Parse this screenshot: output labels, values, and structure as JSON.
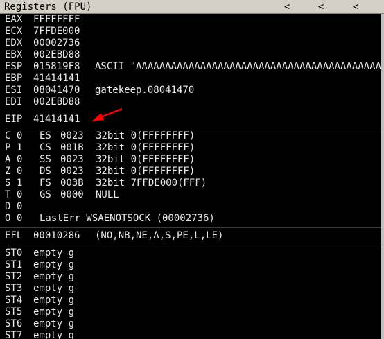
{
  "window": {
    "title": "Registers (FPU)",
    "arrows": [
      "<",
      "<",
      "<"
    ]
  },
  "registers": [
    {
      "name": "EAX",
      "value": "FFFFFFFF",
      "comment": ""
    },
    {
      "name": "ECX",
      "value": "7FFDE000",
      "comment": ""
    },
    {
      "name": "EDX",
      "value": "00002736",
      "comment": ""
    },
    {
      "name": "EBX",
      "value": "002EBD88",
      "comment": ""
    },
    {
      "name": "ESP",
      "value": "015819F8",
      "comment": "ASCII \"AAAAAAAAAAAAAAAAAAAAAAAAAAAAAAAAAAAAAAAAAAAAAAAAAAAAAAAA"
    },
    {
      "name": "EBP",
      "value": "41414141",
      "comment": ""
    },
    {
      "name": "ESI",
      "value": "08041470",
      "comment": "gatekeep.08041470"
    },
    {
      "name": "EDI",
      "value": "002EBD88",
      "comment": ""
    }
  ],
  "eip": {
    "name": "EIP",
    "value": "41414141"
  },
  "flags": [
    {
      "flag": "C",
      "bit": "0",
      "seg": "ES",
      "sel": "0023",
      "desc": "32bit 0(FFFFFFFF)"
    },
    {
      "flag": "P",
      "bit": "1",
      "seg": "CS",
      "sel": "001B",
      "desc": "32bit 0(FFFFFFFF)"
    },
    {
      "flag": "A",
      "bit": "0",
      "seg": "SS",
      "sel": "0023",
      "desc": "32bit 0(FFFFFFFF)"
    },
    {
      "flag": "Z",
      "bit": "0",
      "seg": "DS",
      "sel": "0023",
      "desc": "32bit 0(FFFFFFFF)"
    },
    {
      "flag": "S",
      "bit": "1",
      "seg": "FS",
      "sel": "003B",
      "desc": "32bit 7FFDE000(FFF)"
    },
    {
      "flag": "T",
      "bit": "0",
      "seg": "GS",
      "sel": "0000",
      "desc": "NULL"
    },
    {
      "flag": "D",
      "bit": "0",
      "seg": "",
      "sel": "",
      "desc": ""
    },
    {
      "flag": "O",
      "bit": "0",
      "seg": "",
      "sel": "",
      "desc": "LastErr WSAENOTSOCK (00002736)"
    }
  ],
  "efl": {
    "name": "EFL",
    "value": "00010286",
    "desc": "(NO,NB,NE,A,S,PE,L,LE)"
  },
  "fpu": [
    {
      "name": "ST0",
      "value": "empty g"
    },
    {
      "name": "ST1",
      "value": "empty g"
    },
    {
      "name": "ST2",
      "value": "empty g"
    },
    {
      "name": "ST3",
      "value": "empty g"
    },
    {
      "name": "ST4",
      "value": "empty g"
    },
    {
      "name": "ST5",
      "value": "empty g"
    },
    {
      "name": "ST6",
      "value": "empty g"
    },
    {
      "name": "ST7",
      "value": "empty g"
    }
  ],
  "colors": {
    "background": "#000000",
    "text": "#e8e8e8",
    "titlebar": "#d4d0c8",
    "annotation_arrow": "#ff0000"
  }
}
